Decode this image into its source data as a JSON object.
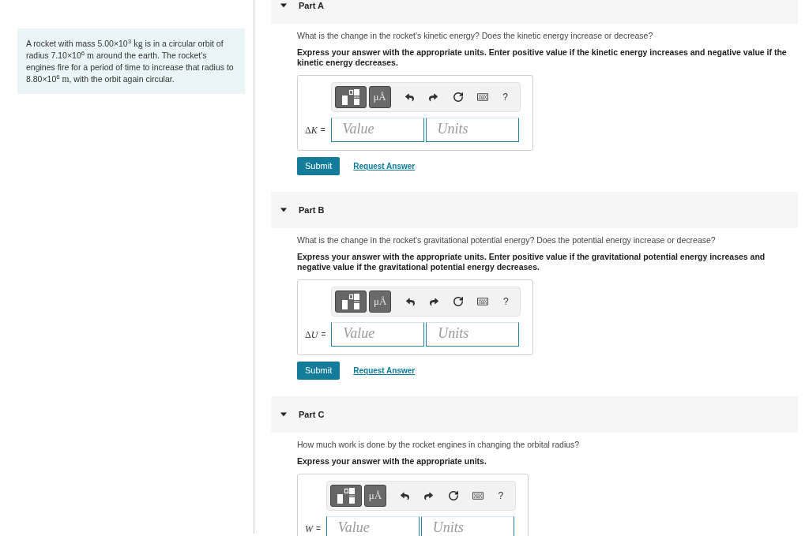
{
  "problem": {
    "segments": [
      {
        "kind": "text",
        "text": "A rocket with mass 5.00×10$^{3}$ "
      },
      {
        "kind": "unit",
        "text": "kg"
      },
      {
        "kind": "text",
        "text": " is in a circular orbit of radius 7.10×10$^{6}$ "
      },
      {
        "kind": "unit",
        "text": "m"
      },
      {
        "kind": "text",
        "text": " around the earth. The rocket's engines fire for a period of time to increase that radius to 8.80×10$^{6}$ "
      },
      {
        "kind": "unit",
        "text": "m"
      },
      {
        "kind": "text",
        "text": ", with the orbit again circular."
      }
    ]
  },
  "parts": [
    {
      "title": "Part A",
      "expanded": true,
      "question": "What is the change in the rocket's kinetic energy? Does the kinetic energy increase or decrease?",
      "instructions": "Express your answer with the appropriate units. Enter positive value if the kinetic energy increases and negative value if the kinetic energy decreases.",
      "units_button": "μÅ",
      "help_button": "?",
      "answer": {
        "delta": "Δ",
        "variable": "K",
        "equals": "=",
        "value_placeholder": "Value",
        "units_placeholder": "Units"
      },
      "submit": "Submit",
      "request_answer": "Request Answer"
    },
    {
      "title": "Part B",
      "expanded": true,
      "question": "What is the change in the rocket's gravitational potential energy? Does the potential energy increase or decrease?",
      "instructions": "Express your answer with the appropriate units. Enter positive value if the gravitational potential energy increases and negative value if the gravitational potential energy decreases.",
      "units_button": "μÅ",
      "help_button": "?",
      "answer": {
        "delta": "Δ",
        "variable": "U",
        "equals": "=",
        "value_placeholder": "Value",
        "units_placeholder": "Units"
      },
      "submit": "Submit",
      "request_answer": "Request Answer"
    },
    {
      "title": "Part C",
      "expanded": true,
      "question": "How much work is done by the rocket engines in changing the orbital radius?",
      "instructions": "Express your answer with the appropriate units.",
      "units_button": "μÅ",
      "help_button": "?",
      "answer": {
        "variable": "W",
        "equals": "=",
        "value_placeholder": "Value",
        "units_placeholder": "Units"
      }
    }
  ]
}
